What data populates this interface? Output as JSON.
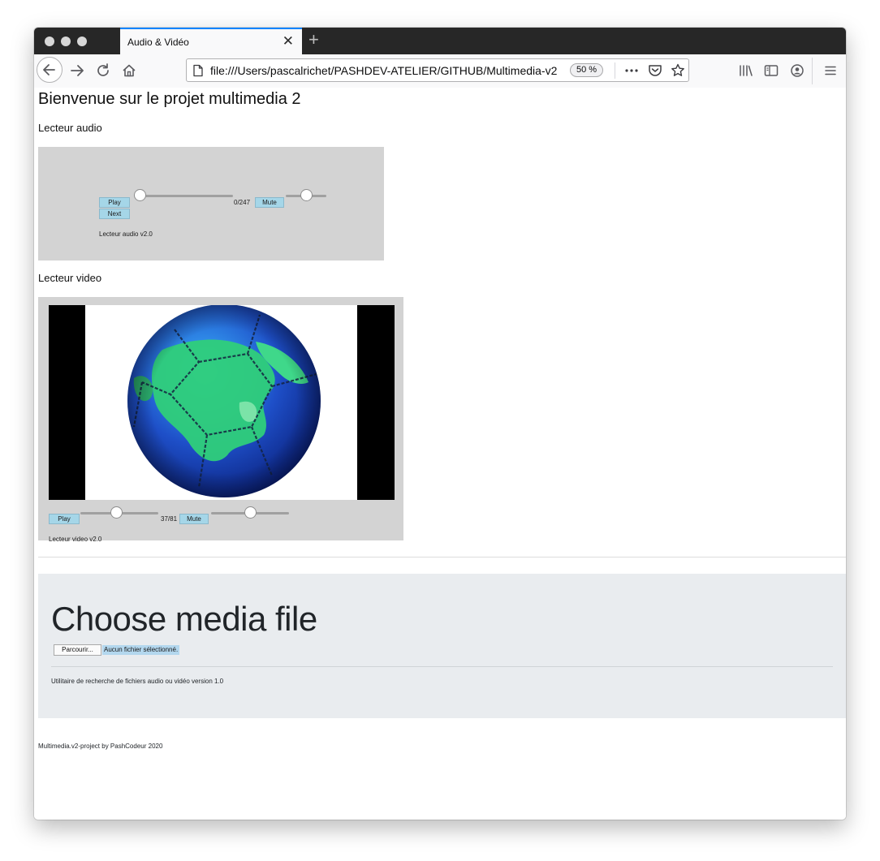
{
  "browser": {
    "tab_title": "Audio & Vidéo",
    "url": "file:///Users/pascalrichet/PASHDEV-ATELIER/GITHUB/Multimedia-v2",
    "zoom": "50 %",
    "icons": [
      "back-icon",
      "forward-icon",
      "reload-icon",
      "home-icon",
      "page-icon",
      "more-icon",
      "pocket-icon",
      "bookmark-star-icon",
      "library-icon",
      "sidebar-icon",
      "account-icon",
      "menu-icon"
    ]
  },
  "page": {
    "title": "Bienvenue sur le projet multimedia 2",
    "audio": {
      "heading": "Lecteur audio",
      "play_label": "Play",
      "next_label": "Next",
      "time": "0/247",
      "mute_label": "Mute",
      "caption": "Lecteur audio v2.0",
      "progress": 0.0,
      "volume": 0.5
    },
    "video": {
      "heading": "Lecteur video",
      "play_label": "Play",
      "time": "37/81",
      "mute_label": "Mute",
      "caption": "Lecteur video v2.0",
      "progress": 0.46,
      "volume": 0.5
    },
    "chooser": {
      "title": "Choose media file",
      "browse_label": "Parcourir...",
      "status": "Aucun fichier sélectionné.",
      "note": "Utilitaire de recherche de fichiers audio ou vidéo version 1.0"
    },
    "footer": "Multimedia.v2-project by PashCodeur 2020"
  },
  "colors": {
    "accent": "#0a84ff",
    "button_bg": "#a5d6e8",
    "player_bg": "#d3d3d3",
    "jumbotron_bg": "#e9ecef"
  }
}
